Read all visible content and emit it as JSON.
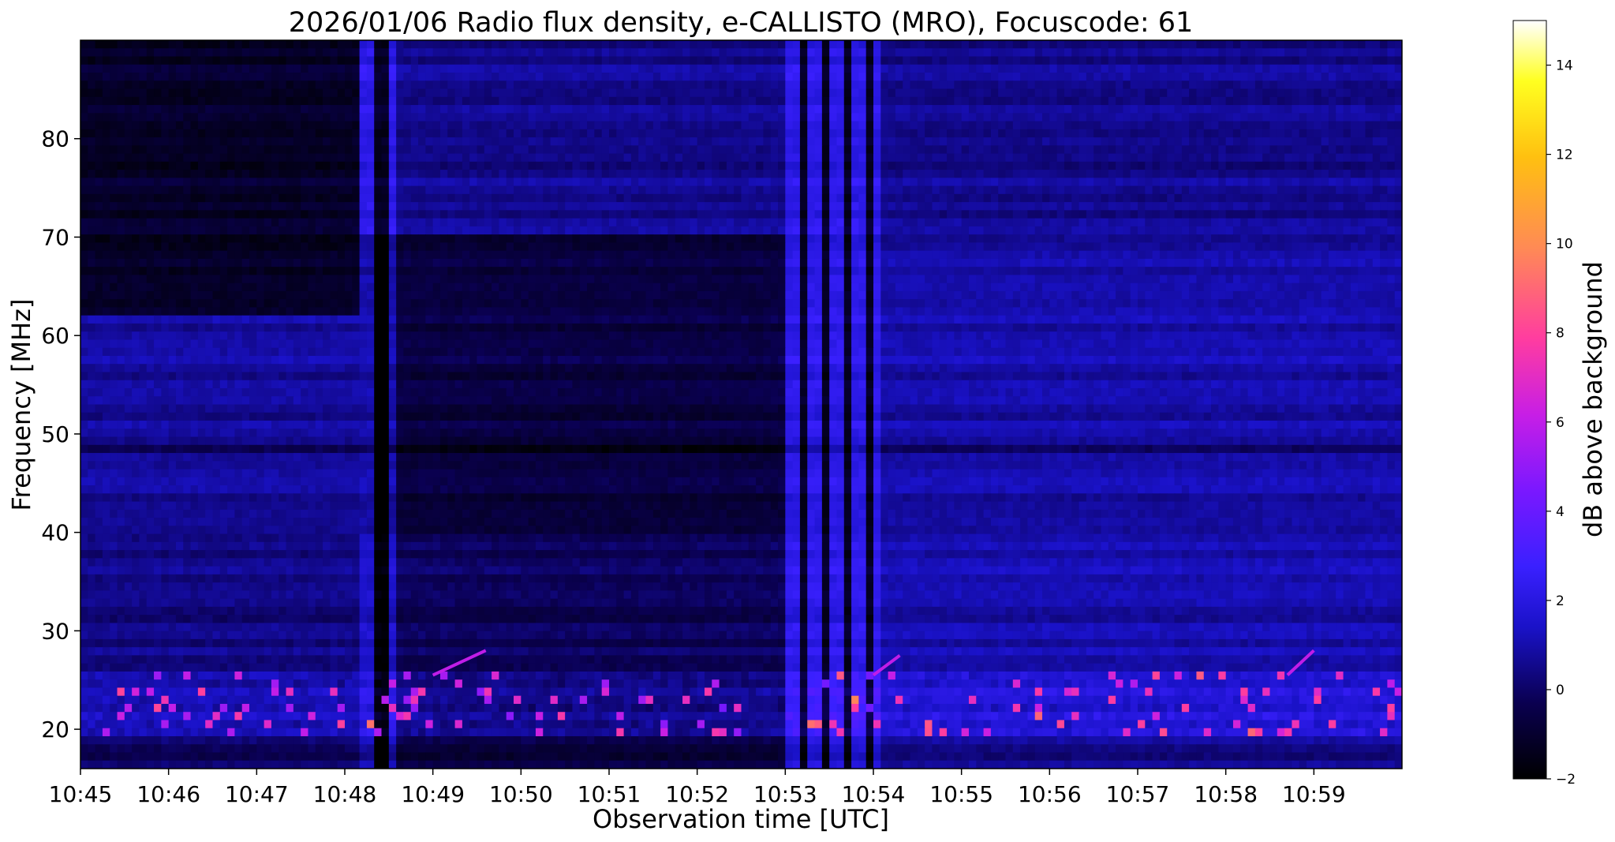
{
  "chart_data": {
    "type": "heatmap",
    "title": "2026/01/06  Radio flux density, e-CALLISTO (MRO), Focuscode: 61",
    "xlabel": "Observation time [UTC]",
    "ylabel": "Frequency [MHz]",
    "colorbar_label": "dB above background",
    "x_ticks": [
      "10:45",
      "10:46",
      "10:47",
      "10:48",
      "10:49",
      "10:50",
      "10:51",
      "10:52",
      "10:53",
      "10:54",
      "10:55",
      "10:56",
      "10:57",
      "10:58",
      "10:59"
    ],
    "y_ticks": [
      20,
      30,
      40,
      50,
      60,
      70,
      80
    ],
    "ylim": [
      16,
      90
    ],
    "colorbar_ticks": [
      -2,
      0,
      2,
      4,
      6,
      8,
      10,
      12,
      14
    ],
    "clim": [
      -2,
      15
    ],
    "colormap": "gnuplot2",
    "features": {
      "broadband_bursts_minutes": [
        {
          "start": 3.2,
          "end": 3.6
        },
        {
          "start": 8.0,
          "end": 9.05
        }
      ],
      "interference_line_mhz": 48.5,
      "bright_band_mhz": [
        19,
        26
      ]
    }
  }
}
